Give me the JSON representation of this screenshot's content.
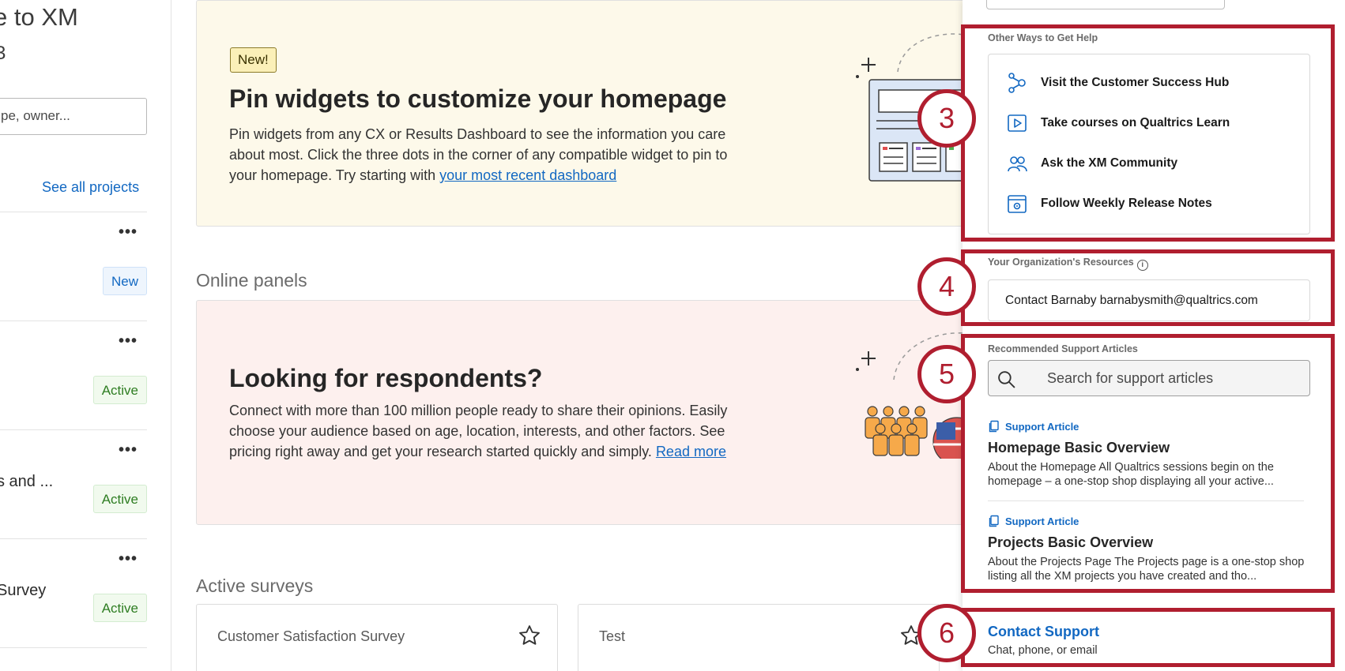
{
  "left": {
    "welcome_partial": "e to XM",
    "welcome_sub_partial": "3",
    "search_placeholder": "pe, owner...",
    "see_all_projects": "See all projects",
    "project_rows": [
      {
        "name": "",
        "status": "New"
      },
      {
        "name": "",
        "status": "Active"
      },
      {
        "name": "s and ...",
        "status": "Active"
      },
      {
        "name": "Survey",
        "status": "Active"
      }
    ],
    "more_glyph": "•••"
  },
  "main": {
    "pin_card": {
      "badge": "New!",
      "title": "Pin widgets to customize your homepage",
      "body": "Pin widgets from any CX or Results Dashboard to see the information you care about most. Click the three dots in the corner of any compatible widget to pin to your homepage. Try starting with",
      "link": "your most recent dashboard"
    },
    "online_panels": {
      "section_title": "Online panels",
      "title": "Looking for respondents?",
      "body": "Connect with more than 100 million people ready to share their opinions. Easily choose your audience based on age, location, interests, and other factors. See pricing right away and get your research started quickly and simply.",
      "link": "Read more"
    },
    "active_surveys": {
      "section_title": "Active surveys",
      "surveys": [
        {
          "name": "Customer Satisfaction Survey"
        },
        {
          "name": "Test"
        }
      ]
    }
  },
  "help_panel": {
    "other_ways_label": "Other Ways to Get Help",
    "links": [
      {
        "label": "Visit the Customer Success Hub",
        "icon": "hub-icon"
      },
      {
        "label": "Take courses on Qualtrics Learn",
        "icon": "play-icon"
      },
      {
        "label": "Ask the XM Community",
        "icon": "community-icon"
      },
      {
        "label": "Follow Weekly Release Notes",
        "icon": "release-notes-icon"
      }
    ],
    "org_resources_label": "Your Organization's Resources",
    "org_contact": "Contact Barnaby barnabysmith@qualtrics.com",
    "recommended_label": "Recommended Support Articles",
    "support_search_placeholder": "Search for support articles",
    "articles": [
      {
        "tag": "Support Article",
        "title": "Homepage Basic Overview",
        "desc": "About the Homepage All Qualtrics sessions begin on the homepage – a one-stop shop displaying all your active..."
      },
      {
        "tag": "Support Article",
        "title": "Projects Basic Overview",
        "desc": "About the Projects Page The Projects page is a one-stop shop listing all the XM projects you have created and tho..."
      }
    ],
    "contact_support": "Contact Support",
    "contact_support_sub": "Chat, phone, or email"
  },
  "annotations": {
    "markers": [
      "3",
      "4",
      "5",
      "6"
    ],
    "color": "#b01e2f"
  },
  "colors": {
    "link_blue": "#1268c2",
    "active_green": "#2e7d22",
    "pin_card_bg": "#fdf9ea",
    "panel_card_bg": "#fdf0ee"
  }
}
